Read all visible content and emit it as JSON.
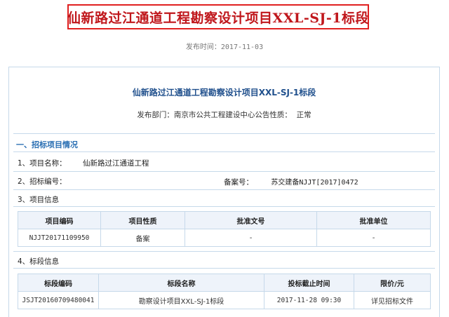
{
  "headline": "仙新路过江通道工程勘察设计项目XXL-SJ-1标段",
  "publish": {
    "label": "发布时间：",
    "date": "2017-11-03"
  },
  "panel": {
    "title": "仙新路过江通道工程勘察设计项目XXL-SJ-1标段",
    "dept_label": "发布部门：",
    "dept": "南京市公共工程建设中心",
    "nature_label": "公告性质：",
    "nature": "正常"
  },
  "section1": {
    "heading": "一、招标项目情况",
    "project_name_label": "1、项目名称：",
    "project_name": "仙新路过江通道工程",
    "tender_no_label": "2、招标编号：",
    "record_no_label": "备案号：",
    "record_no": "苏交建备NJJT[2017]0472",
    "project_info_label": "3、项目信息",
    "project_table": {
      "headers": [
        "项目编码",
        "项目性质",
        "批准文号",
        "批准单位"
      ],
      "rows": [
        [
          "NJJT20171109950",
          "备案",
          "-",
          "-"
        ]
      ]
    },
    "section_info_label": "4、标段信息",
    "section_table": {
      "headers": [
        "标段编码",
        "标段名称",
        "投标截止时间",
        "限价/元"
      ],
      "rows": [
        [
          "JSJT20160709480041",
          "勘察设计项目XXL-SJ-1标段",
          "2017-11-28 09:30",
          "详见招标文件"
        ]
      ]
    }
  }
}
